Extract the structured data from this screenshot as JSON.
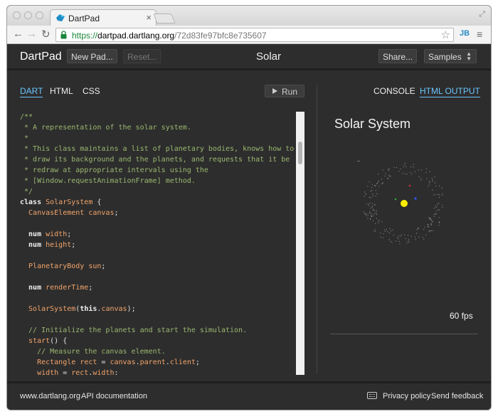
{
  "browser": {
    "tab_title": "DartPad",
    "url_scheme": "https://",
    "url_host": "dartpad.dartlang.org",
    "url_path": "/72d83fe97bfc8e735607",
    "extension_label": "JB"
  },
  "header": {
    "logo": "DartPad",
    "new_pad": "New Pad...",
    "reset": "Reset...",
    "title": "Solar",
    "share": "Share...",
    "samples": "Samples"
  },
  "editor_tabs": {
    "dart": "DART",
    "html": "HTML",
    "css": "CSS",
    "run": "Run"
  },
  "code": [
    [
      [
        "comment",
        "/**"
      ]
    ],
    [
      [
        "comment",
        " * A representation of the solar system."
      ]
    ],
    [
      [
        "comment",
        " *"
      ]
    ],
    [
      [
        "comment",
        " * This class maintains a list of planetary bodies, knows how to"
      ]
    ],
    [
      [
        "comment",
        " * draw its background and the planets, and requests that it be"
      ]
    ],
    [
      [
        "comment",
        " * redraw at appropriate intervals using the"
      ]
    ],
    [
      [
        "comment",
        " * [Window.requestAnimationFrame] method."
      ]
    ],
    [
      [
        "comment",
        " */"
      ]
    ],
    [
      [
        "keyword",
        "class "
      ],
      [
        "type",
        "SolarSystem"
      ],
      [
        "plain",
        " {"
      ]
    ],
    [
      [
        "type",
        "  CanvasElement"
      ],
      [
        "plain",
        " "
      ],
      [
        "type",
        "canvas"
      ],
      [
        "plain",
        ";"
      ]
    ],
    [],
    [
      [
        "keyword",
        "  num "
      ],
      [
        "type",
        "width"
      ],
      [
        "plain",
        ";"
      ]
    ],
    [
      [
        "keyword",
        "  num "
      ],
      [
        "type",
        "height"
      ],
      [
        "plain",
        ";"
      ]
    ],
    [],
    [
      [
        "type",
        "  PlanetaryBody"
      ],
      [
        "plain",
        " "
      ],
      [
        "type",
        "sun"
      ],
      [
        "plain",
        ";"
      ]
    ],
    [],
    [
      [
        "keyword",
        "  num "
      ],
      [
        "type",
        "renderTime"
      ],
      [
        "plain",
        ";"
      ]
    ],
    [],
    [
      [
        "type",
        "  SolarSystem"
      ],
      [
        "plain",
        "("
      ],
      [
        "keyword",
        "this"
      ],
      [
        "plain",
        "."
      ],
      [
        "type",
        "canvas"
      ],
      [
        "plain",
        ");"
      ]
    ],
    [],
    [
      [
        "comment",
        "  // Initialize the planets and start the simulation."
      ]
    ],
    [
      [
        "plain",
        "  "
      ],
      [
        "type",
        "start"
      ],
      [
        "plain",
        "() {"
      ]
    ],
    [
      [
        "comment",
        "    // Measure the canvas element."
      ]
    ],
    [
      [
        "type",
        "    Rectangle"
      ],
      [
        "plain",
        " "
      ],
      [
        "type",
        "rect"
      ],
      [
        "plain",
        " = "
      ],
      [
        "type",
        "canvas"
      ],
      [
        "plain",
        "."
      ],
      [
        "type",
        "parent"
      ],
      [
        "plain",
        "."
      ],
      [
        "type",
        "client"
      ],
      [
        "plain",
        ";"
      ]
    ],
    [
      [
        "type",
        "    width"
      ],
      [
        "plain",
        " = "
      ],
      [
        "type",
        "rect"
      ],
      [
        "plain",
        "."
      ],
      [
        "type",
        "width"
      ],
      [
        "plain",
        ";"
      ]
    ]
  ],
  "output_tabs": {
    "console": "CONSOLE",
    "html_output": "HTML OUTPUT"
  },
  "output": {
    "title": "Solar System",
    "fps": "60 fps"
  },
  "footer": {
    "site": "www.dartlang.org",
    "api": "API documentation",
    "privacy": "Privacy policy",
    "feedback": "Send feedback"
  },
  "colors": {
    "accent": "#6bc6ff",
    "background": "#2d2d2d",
    "comment": "#9ab870",
    "identifier": "#f3a46b",
    "sun": "#ffee00"
  }
}
